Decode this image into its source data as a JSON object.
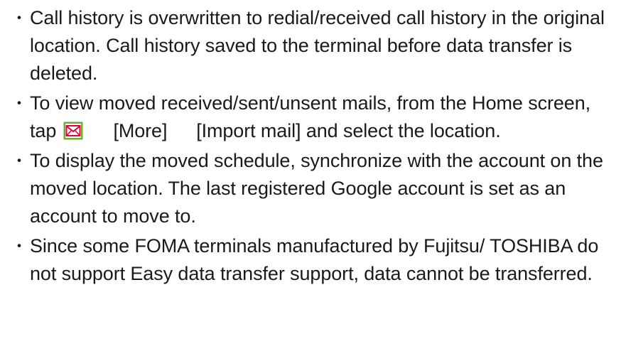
{
  "notes": {
    "items": [
      {
        "bullet": "・",
        "text": "Call history is overwritten to redial/received call history in the original location. Call history saved to the terminal before data transfer is deleted."
      },
      {
        "bullet": "・",
        "text_before_icon": "To view moved received/sent/unsent mails, from the Home screen, tap",
        "icon": "mail-icon",
        "step_1": "[More]",
        "step_2": "[Import mail] and select the location."
      },
      {
        "bullet": "・",
        "text": "To display the moved schedule, synchronize with the account on the moved location. The last registered Google account is set as an account to move to."
      },
      {
        "bullet": "・",
        "text": "Since some FOMA terminals manufactured by Fujitsu/ TOSHIBA do not support Easy data transfer support, data cannot be transferred."
      }
    ]
  },
  "colors": {
    "text": "#1a1a1a",
    "icon_red": "#e0003c",
    "icon_green": "#6ab22e"
  }
}
